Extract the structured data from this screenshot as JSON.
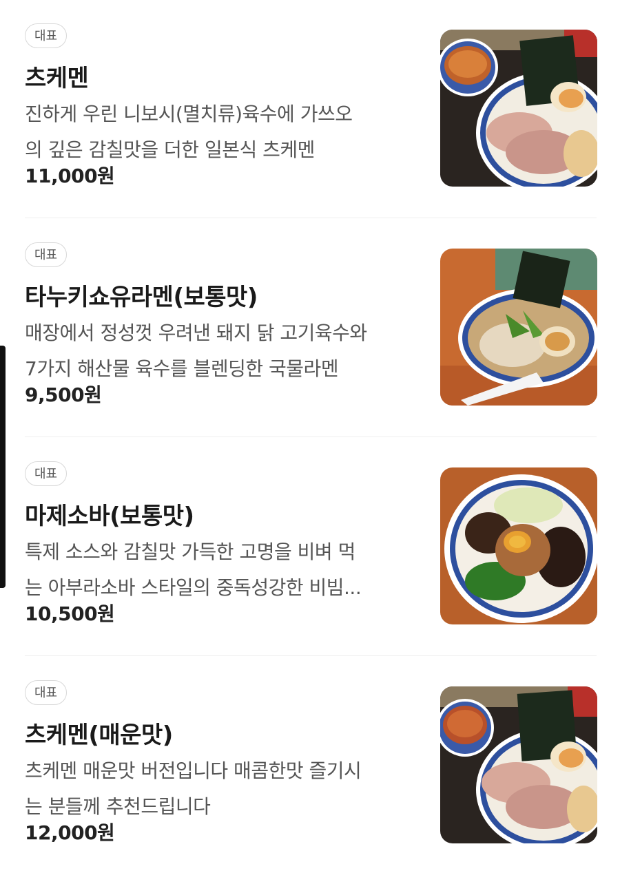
{
  "menu": {
    "items": [
      {
        "badge": "대표",
        "name": "츠케멘",
        "desc_line1": "진하게 우린 니보시(멸치류)육수에 가쓰오",
        "desc_line2": "의 깊은 감칠맛을 더한 일본식 츠케멘",
        "price": "11,000원"
      },
      {
        "badge": "대표",
        "name": "타누키쇼유라멘(보통맛)",
        "desc_line1": "매장에서 정성껏 우려낸 돼지 닭 고기육수와",
        "desc_line2": "7가지 해산물 육수를 블렌딩한 국물라멘",
        "price": "9,500원"
      },
      {
        "badge": "대표",
        "name": "마제소바(보통맛)",
        "desc_line1": "특제 소스와 감칠맛 가득한 고명을 비벼 먹",
        "desc_line2": "는 아부라소바 스타일의 중독성강한 비빔...",
        "price": "10,500원"
      },
      {
        "badge": "대표",
        "name": "츠케멘(매운맛)",
        "desc_line1": "츠케멘 매운맛 버전입니다 매콤한맛 즐기시",
        "desc_line2": "는 분들께 추천드립니다",
        "price": "12,000원"
      }
    ]
  },
  "colors": {
    "badge_border": "#d8d8d8",
    "text_primary": "#1a1a1a",
    "text_secondary": "#555555",
    "divider": "#eeeeee"
  }
}
